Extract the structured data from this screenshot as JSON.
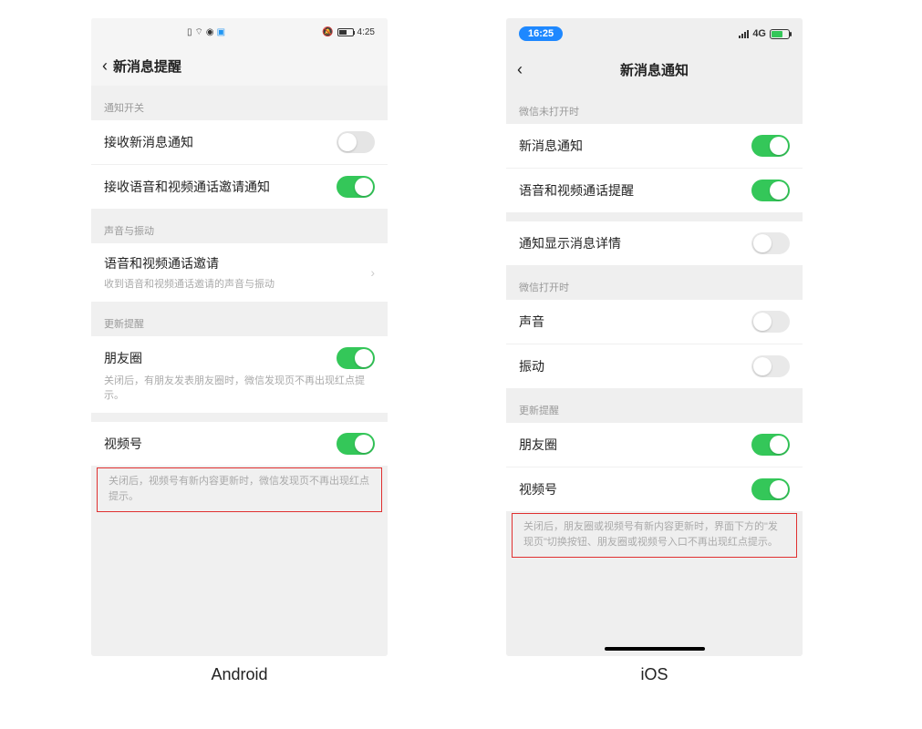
{
  "android": {
    "caption": "Android",
    "status": {
      "time": "4:25"
    },
    "header": {
      "title": "新消息提醒"
    },
    "groups": {
      "notif_switch": "通知开关",
      "sound_vib": "声音与振动",
      "update": "更新提醒"
    },
    "items": {
      "receive_msg": "接收新消息通知",
      "receive_av": "接收语音和视频通话邀请通知",
      "av_invite": "语音和视频通话邀请",
      "av_invite_sub": "收到语音和视频通话邀请的声音与振动",
      "moments": "朋友圈",
      "moments_sub": "关闭后，有朋友发表朋友圈时，微信发现页不再出现红点提示。",
      "channels": "视频号",
      "channels_note": "关闭后，视频号有新内容更新时，微信发现页不再出现红点提示。"
    }
  },
  "ios": {
    "caption": "iOS",
    "status": {
      "time": "16:25",
      "net": "4G"
    },
    "header": {
      "title": "新消息通知"
    },
    "groups": {
      "closed": "微信未打开时",
      "open": "微信打开时",
      "update": "更新提醒"
    },
    "items": {
      "msg_notify": "新消息通知",
      "av_remind": "语音和视频通话提醒",
      "show_detail": "通知显示消息详情",
      "sound": "声音",
      "vibration": "振动",
      "moments": "朋友圈",
      "channels": "视频号",
      "note": "关闭后，朋友圈或视频号有新内容更新时，界面下方的\"发现页\"切换按钮、朋友圈或视频号入口不再出现红点提示。"
    }
  }
}
